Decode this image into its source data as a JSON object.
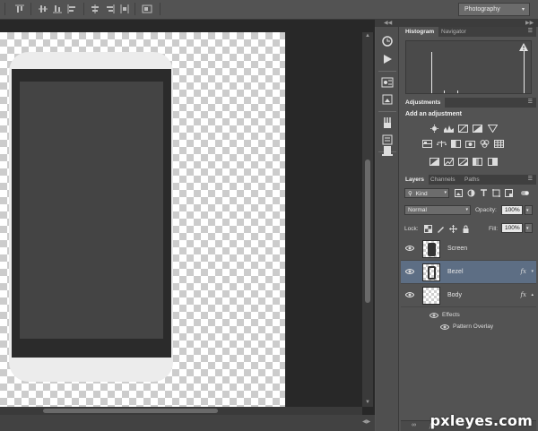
{
  "options_bar": {
    "workspace": "Photography",
    "align_buttons": [
      "align-top-edges-icon",
      "align-vertical-centers-icon",
      "align-bottom-edges-icon",
      "align-left-edges-icon",
      "align-horizontal-centers-icon",
      "align-right-edges-icon",
      "auto-align-icon"
    ]
  },
  "histogram_panel": {
    "tabs": [
      "Histogram",
      "Navigator"
    ],
    "active_tab": "Histogram",
    "warning_icon": "cache-warning-icon"
  },
  "adjustments_panel": {
    "tab": "Adjustments",
    "heading": "Add an adjustment",
    "row1": [
      "brightness-contrast-icon",
      "levels-icon",
      "curves-icon",
      "exposure-icon",
      "vibrance-icon"
    ],
    "row2": [
      "hue-saturation-icon",
      "color-balance-icon",
      "black-white-icon",
      "photo-filter-icon",
      "channel-mixer-icon",
      "color-lookup-icon"
    ],
    "row3": [
      "invert-icon",
      "posterize-icon",
      "threshold-icon",
      "gradient-map-icon",
      "selective-color-icon"
    ]
  },
  "layers_panel": {
    "tabs": [
      "Layers",
      "Channels",
      "Paths"
    ],
    "active_tab": "Layers",
    "filter_kind": "Kind",
    "blend_mode": "Normal",
    "opacity_label": "Opacity:",
    "opacity_value": "100%",
    "lock_label": "Lock:",
    "fill_label": "Fill:",
    "fill_value": "100%",
    "layers": [
      {
        "name": "Screen",
        "selected": false,
        "has_fx": false
      },
      {
        "name": "Bezel",
        "selected": true,
        "has_fx": true
      },
      {
        "name": "Body",
        "selected": false,
        "has_fx": true
      }
    ],
    "effects_label": "Effects",
    "effects": [
      "Pattern Overlay"
    ],
    "footer_fx": "fx"
  },
  "watermark": "pxleyes.com",
  "colors": {
    "ui_gray": "#535353",
    "panel_dark": "#3f3f3f",
    "selection": "#5d6e84",
    "canvas_pasteboard": "#282828",
    "phone_body": "#ececec",
    "phone_bezel": "#2b2b2b",
    "phone_screen": "#444444"
  }
}
